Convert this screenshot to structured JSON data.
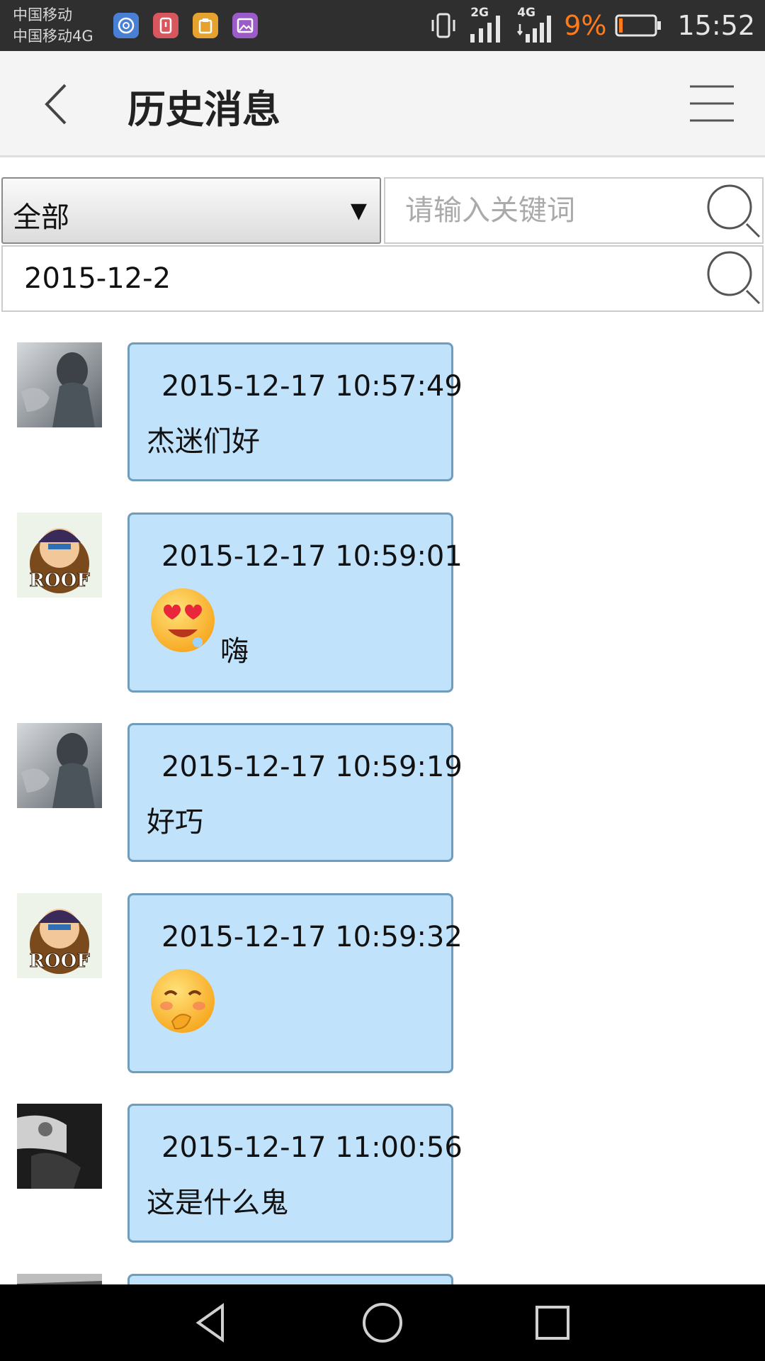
{
  "status_bar": {
    "carrier_1": "中国移动",
    "carrier_2": "中国移动4G",
    "network_1": "2G",
    "network_2": "4G",
    "battery": "9%",
    "time": "15:52",
    "battery_color": "#ff7a1a"
  },
  "header": {
    "title": "历史消息",
    "back_icon": "chevron-left-icon",
    "menu_icon": "hamburger-menu-icon"
  },
  "filters": {
    "category_value": "全部",
    "dropdown_arrow": "▼",
    "keyword_placeholder": "请输入关键词",
    "keyword_value": "",
    "date_value": "2015-12-2"
  },
  "messages": [
    {
      "time": "2015-12-17 10:57:49",
      "text": "杰迷们好",
      "avatar": "avatar-man-smoke",
      "emoji": null
    },
    {
      "time": "2015-12-17 10:59:01",
      "text": "嗨",
      "avatar": "avatar-roof-cartoon",
      "emoji": "heart-eyes-emoji"
    },
    {
      "time": "2015-12-17 10:59:19",
      "text": "好巧",
      "avatar": "avatar-man-smoke",
      "emoji": null
    },
    {
      "time": "2015-12-17 10:59:32",
      "text": "",
      "avatar": "avatar-roof-cartoon",
      "emoji": "shy-smile-emoji"
    },
    {
      "time": "2015-12-17 11:00:56",
      "text": "这是什么鬼",
      "avatar": "avatar-dark-photo",
      "emoji": null
    }
  ],
  "avatar_badge_text": "ROOF",
  "colors": {
    "bubble_fill": "#c0e2fb",
    "bubble_border": "#6f9dbb",
    "header_bg": "#f4f4f4",
    "status_bar_bg": "#2f2f2f"
  }
}
